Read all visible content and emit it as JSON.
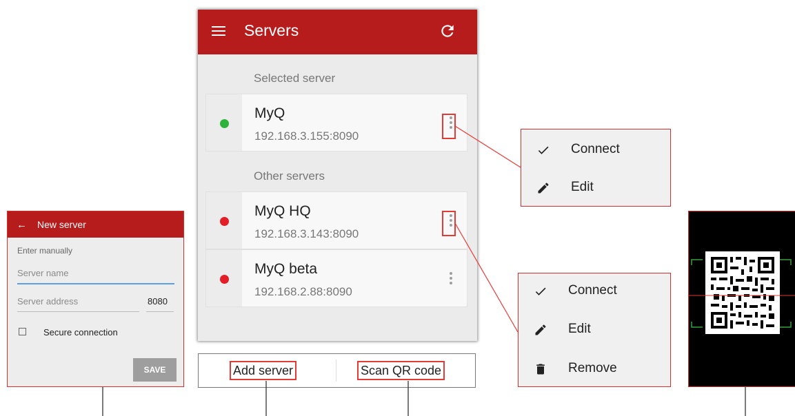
{
  "main": {
    "title": "Servers",
    "selected_section": "Selected server",
    "other_section": "Other servers",
    "servers": [
      {
        "name": "MyQ",
        "address": "192.168.3.155:8090",
        "status_color": "#2db33b"
      },
      {
        "name": "MyQ HQ",
        "address": "192.168.3.143:8090",
        "status_color": "#e31e26"
      },
      {
        "name": "MyQ beta",
        "address": "192.168.2.88:8090",
        "status_color": "#e31e26"
      }
    ]
  },
  "bottom_bar": {
    "add_server": "Add server",
    "scan_qr": "Scan QR code"
  },
  "menu_selected": {
    "connect": "Connect",
    "edit": "Edit"
  },
  "menu_other": {
    "connect": "Connect",
    "edit": "Edit",
    "remove": "Remove"
  },
  "new_server": {
    "title": "New server",
    "enter_manually": "Enter manually",
    "server_name_placeholder": "Server name",
    "server_address_placeholder": "Server address",
    "port": "8080",
    "secure_connection": "Secure connection",
    "save": "SAVE"
  },
  "colors": {
    "accent": "#b71c1c",
    "callout": "#e53935"
  }
}
